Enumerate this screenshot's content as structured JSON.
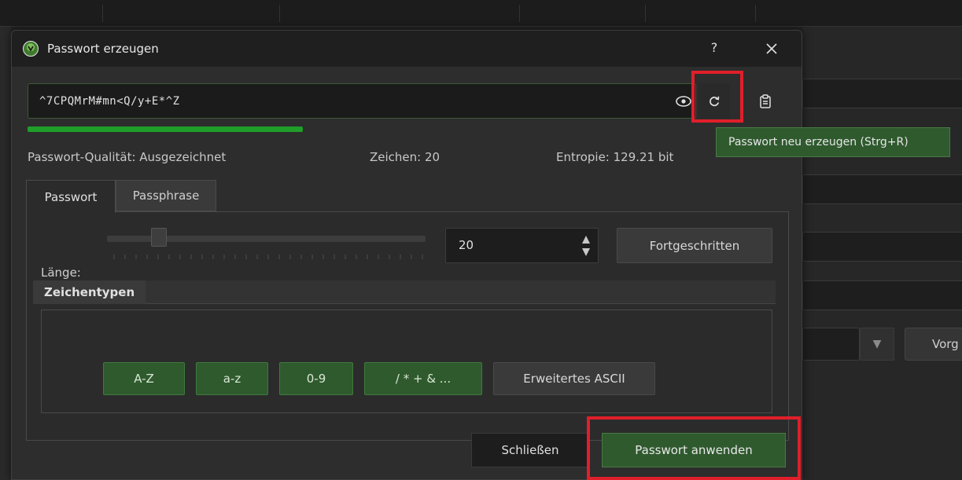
{
  "dialog": {
    "title": "Passwort erzeugen",
    "help_label": "?",
    "password": {
      "value": "^7CPQMrM#mn<Q/y+E*^Z",
      "quality_fraction": 0.65
    },
    "tooltip": "Passwort neu erzeugen (Strg+R)",
    "stats": {
      "quality": "Passwort-Qualität: Ausgezeichnet",
      "chars": "Zeichen: 20",
      "entropy": "Entropie: 129.21 bit"
    },
    "tabs": [
      {
        "label": "Passwort",
        "active": true
      },
      {
        "label": "Passphrase",
        "active": false
      }
    ],
    "length": {
      "label": "Länge:",
      "value": "20",
      "advanced_label": "Fortgeschritten"
    },
    "char_types": {
      "title": "Zeichentypen",
      "items": [
        {
          "label": "A-Z",
          "enabled": true
        },
        {
          "label": "a-z",
          "enabled": true
        },
        {
          "label": "0-9",
          "enabled": true
        },
        {
          "label": "/ * + & ...",
          "enabled": true
        },
        {
          "label": "Erweitertes ASCII",
          "enabled": false
        }
      ]
    },
    "buttons": {
      "close": "Schließen",
      "apply": "Passwort anwenden"
    }
  },
  "background": {
    "partial_button": "Vorg"
  },
  "colors": {
    "accent_green": "#2f5a2e",
    "quality_bar": "#1f9e2a",
    "highlight_red": "#e01f2b"
  }
}
